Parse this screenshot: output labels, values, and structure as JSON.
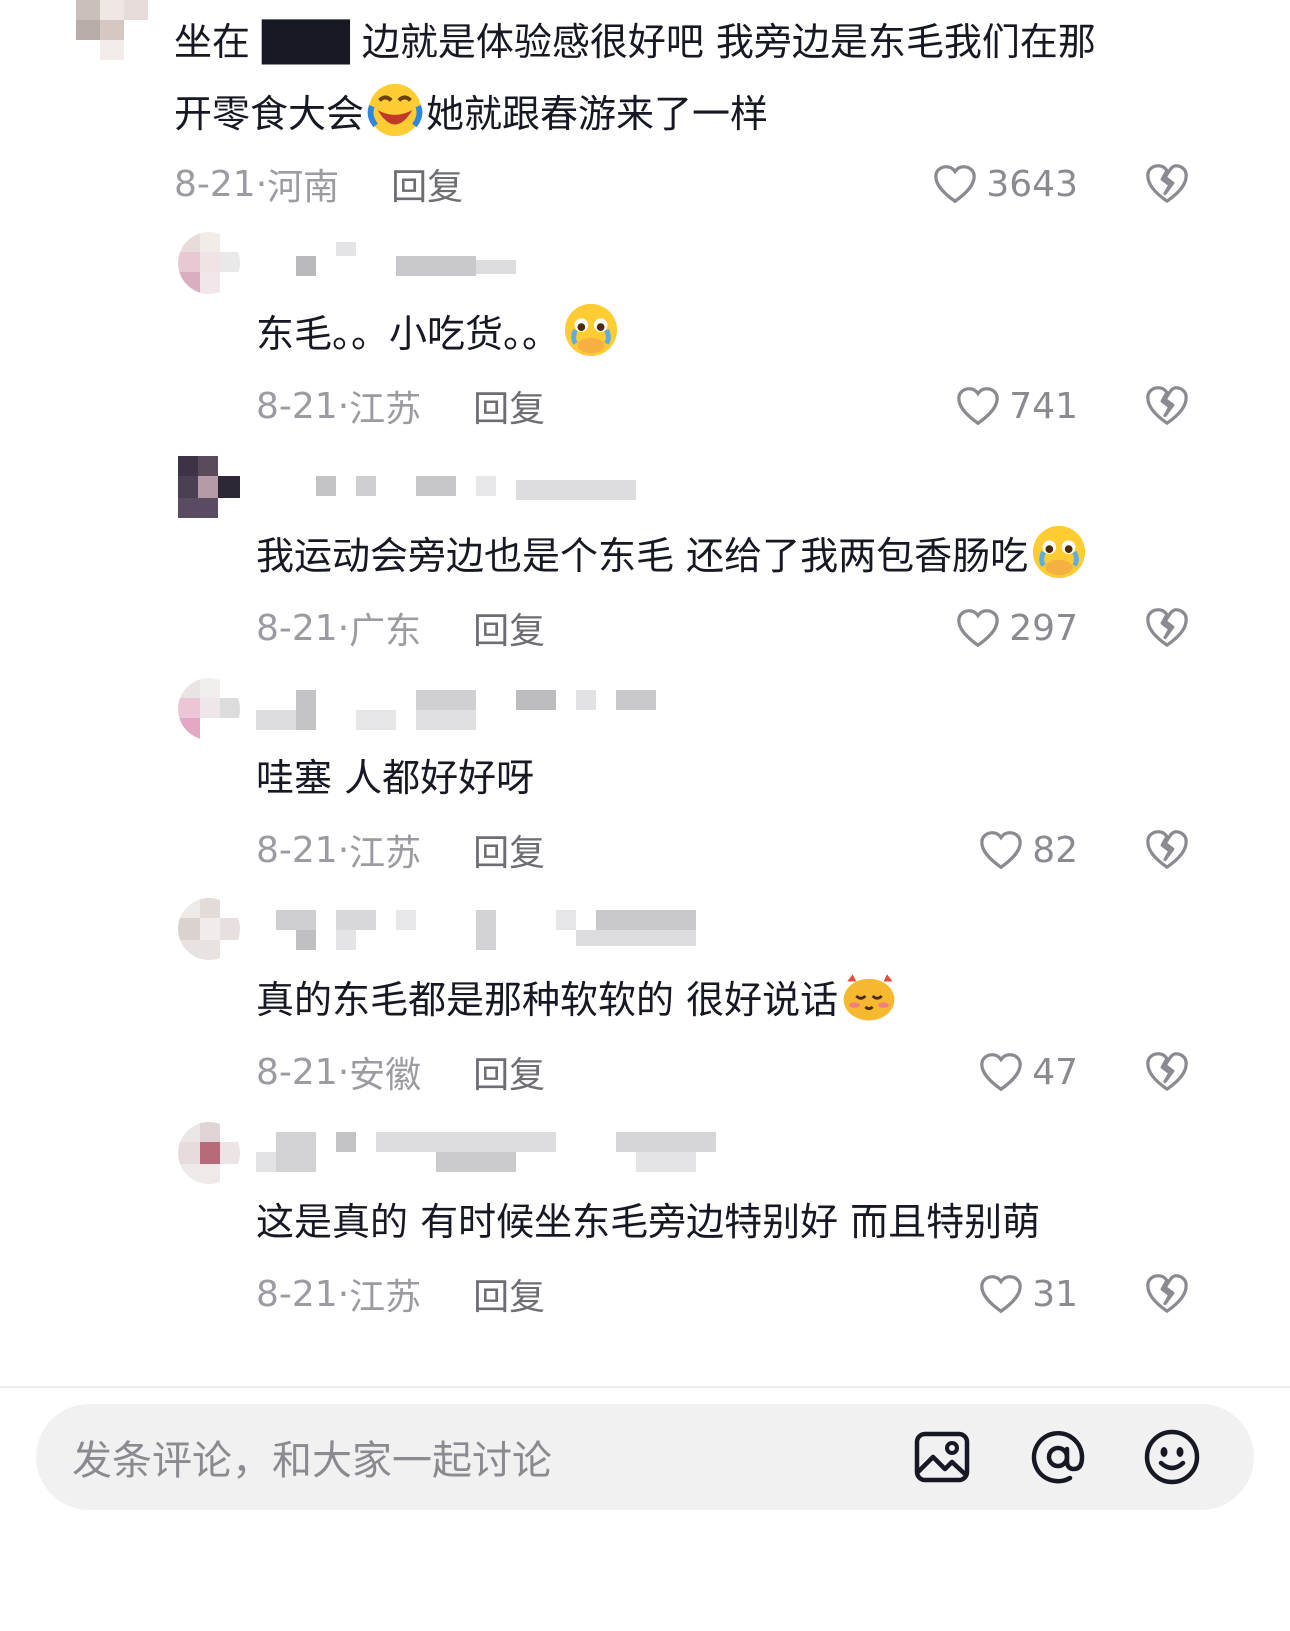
{
  "comments": [
    {
      "text_line1": "坐在 ███ 边就是体验感很好吧 我旁边是东毛我们在那",
      "text_line2a": "开零食大会",
      "text_line2b": "她就跟春游来了一样",
      "date": "8-21",
      "location": "河南",
      "reply_label": "回复",
      "likes": "3643"
    },
    {
      "text": "东毛。。小吃货。。",
      "date": "8-21",
      "location": "江苏",
      "reply_label": "回复",
      "likes": "741"
    },
    {
      "text": "我运动会旁边也是个东毛 还给了我两包香肠吃",
      "date": "8-21",
      "location": "广东",
      "reply_label": "回复",
      "likes": "297"
    },
    {
      "text": "哇塞 人都好好呀",
      "date": "8-21",
      "location": "江苏",
      "reply_label": "回复",
      "likes": "82"
    },
    {
      "text": "真的东毛都是那种软软的 很好说话",
      "date": "8-21",
      "location": "安徽",
      "reply_label": "回复",
      "likes": "47"
    },
    {
      "text": "这是真的 有时候坐东毛旁边特别好 而且特别萌",
      "date": "8-21",
      "location": "江苏",
      "reply_label": "回复",
      "likes": "31"
    }
  ],
  "composer": {
    "placeholder": "发条评论，和大家一起讨论"
  },
  "colors": {
    "text": "#161823",
    "meta": "#9b9ca1",
    "reply": "#6d6e73",
    "input_bg": "#f1f1f2"
  }
}
